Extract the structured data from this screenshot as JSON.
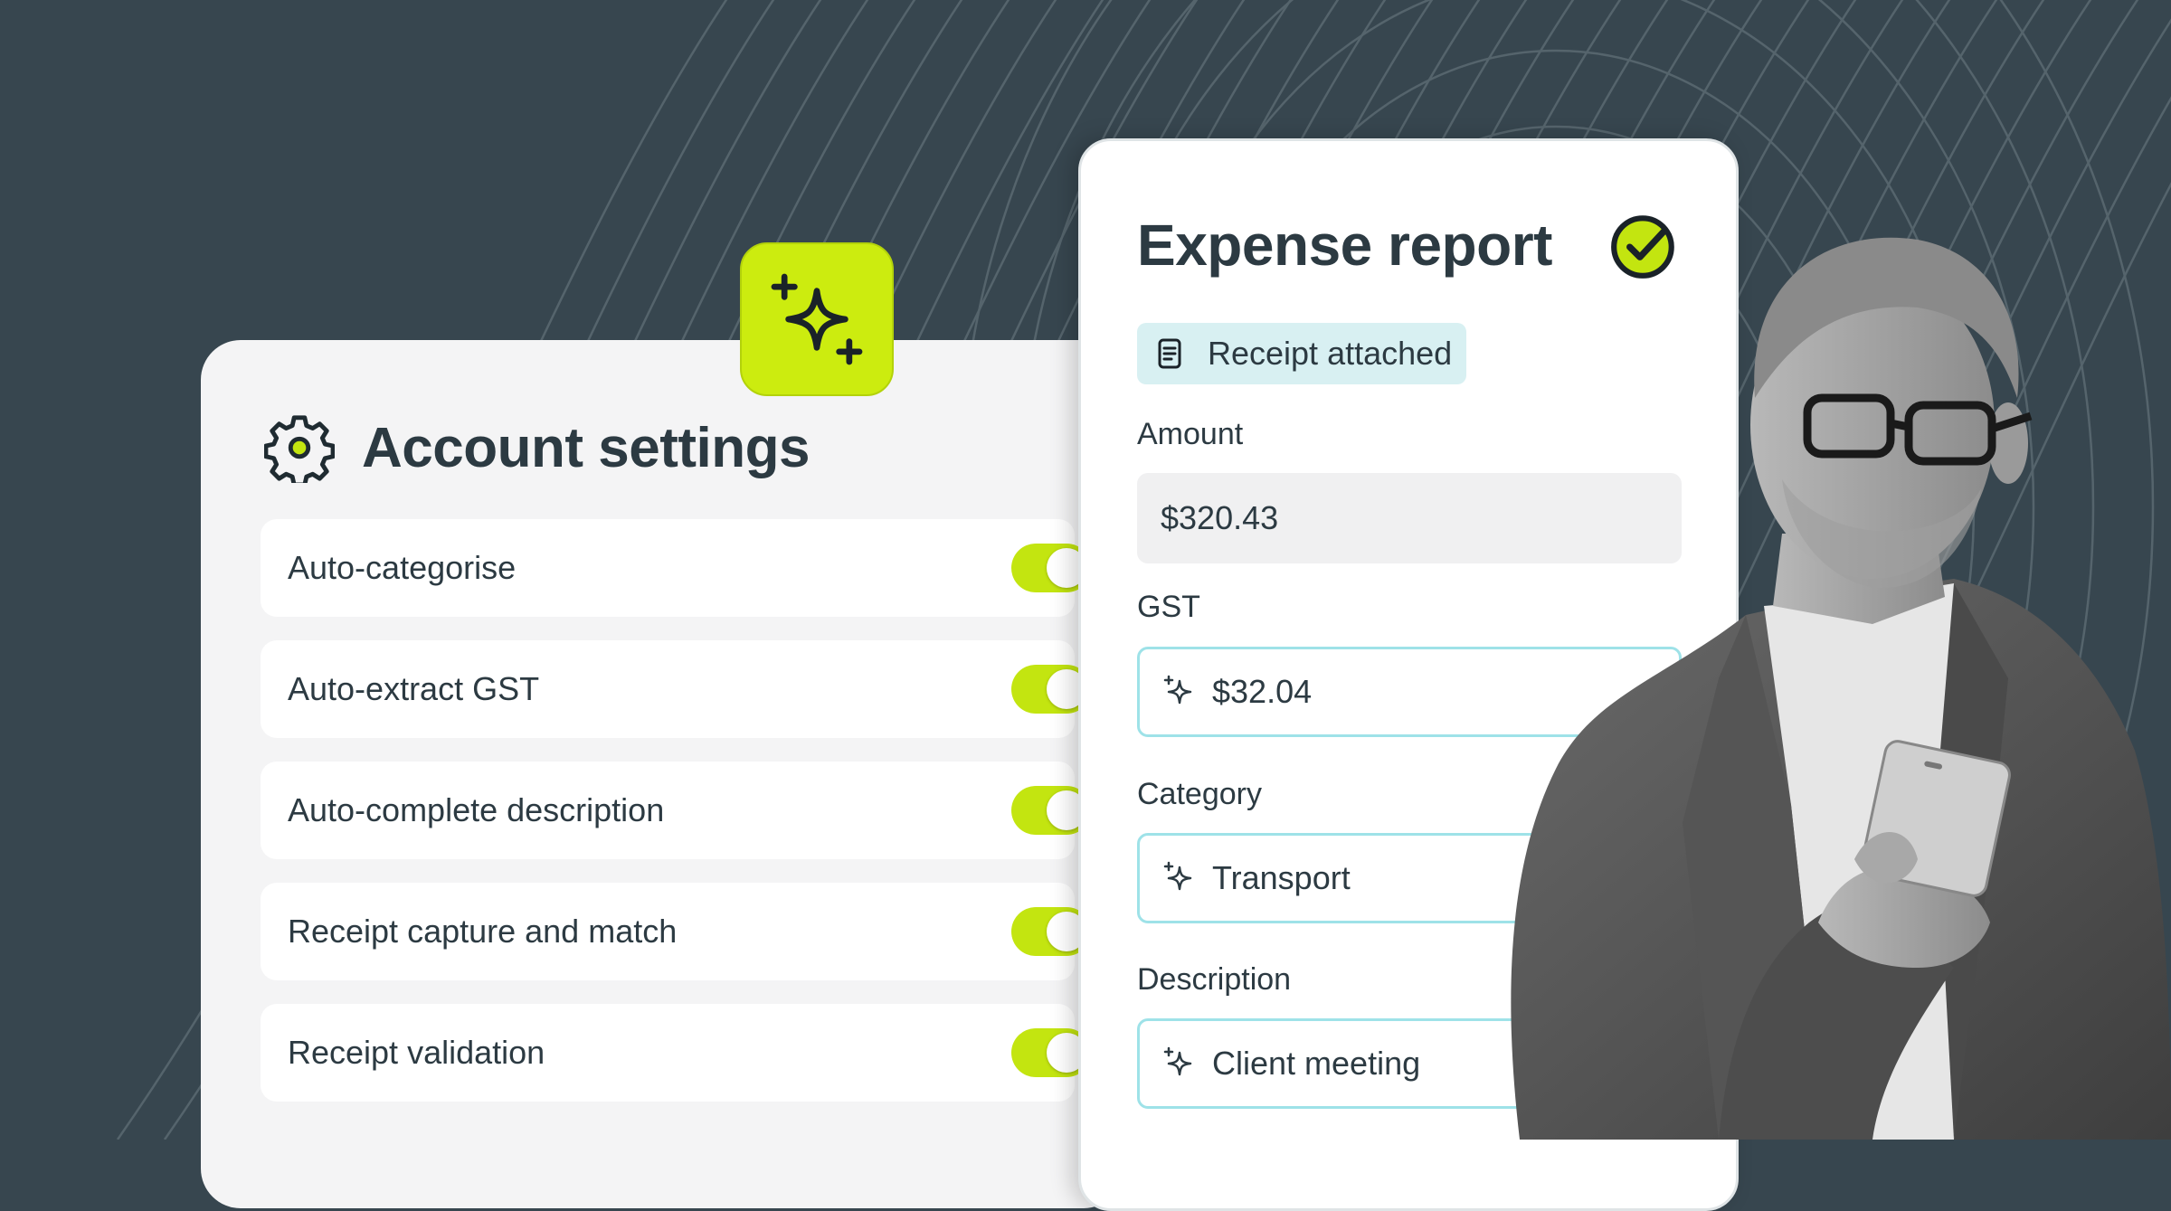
{
  "settings": {
    "title": "Account settings",
    "options": [
      {
        "label": "Auto-categorise",
        "enabled": true
      },
      {
        "label": "Auto-extract GST",
        "enabled": true
      },
      {
        "label": "Auto-complete description",
        "enabled": true
      },
      {
        "label": "Receipt capture and match",
        "enabled": true
      },
      {
        "label": "Receipt validation",
        "enabled": true
      }
    ]
  },
  "expense": {
    "title": "Expense report",
    "receipt_status": "Receipt attached",
    "fields": [
      {
        "label": "Amount",
        "value": "$320.43"
      },
      {
        "label": "GST",
        "value": "$32.04"
      },
      {
        "label": "Category",
        "value": "Transport"
      },
      {
        "label": "Description",
        "value": "Client meeting"
      }
    ]
  },
  "colors": {
    "background": "#37464f",
    "accent": "#c3e510",
    "text": "#2c3a42",
    "ai_border": "#9ee2e8"
  },
  "icons": [
    "gear-icon",
    "sparkle-icon",
    "check-circle-icon",
    "receipt-icon",
    "ai-sparkle-icon"
  ]
}
